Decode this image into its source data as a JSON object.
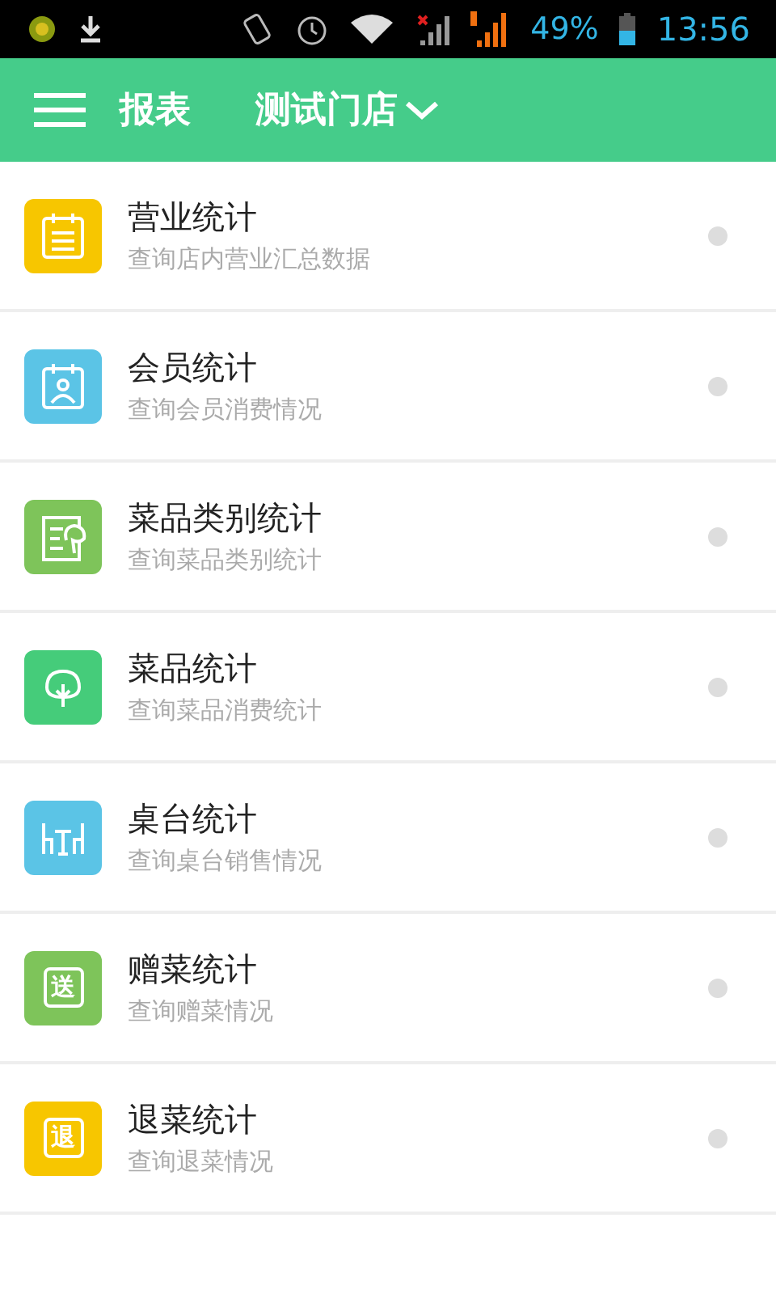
{
  "status_bar": {
    "battery": "49%",
    "time": "13:56"
  },
  "app_bar": {
    "title": "报表",
    "store": "测试门店"
  },
  "items": [
    {
      "title": "营业统计",
      "subtitle": "查询店内营业汇总数据",
      "kind": "list",
      "color": "#f7c600"
    },
    {
      "title": "会员统计",
      "subtitle": "查询会员消费情况",
      "kind": "member",
      "color": "#5bc4e6"
    },
    {
      "title": "菜品类别统计",
      "subtitle": "查询菜品类别统计",
      "kind": "category",
      "color": "#7ec45a"
    },
    {
      "title": "菜品统计",
      "subtitle": "查询菜品消费统计",
      "kind": "dish",
      "color": "#45cc7a"
    },
    {
      "title": "桌台统计",
      "subtitle": "查询桌台销售情况",
      "kind": "table",
      "color": "#5bc4e6"
    },
    {
      "title": "赠菜统计",
      "subtitle": "查询赠菜情况",
      "kind": "glyph",
      "glyph": "送",
      "color": "#7ec45a"
    },
    {
      "title": "退菜统计",
      "subtitle": "查询退菜情况",
      "kind": "glyph",
      "glyph": "退",
      "color": "#f7c600"
    }
  ]
}
